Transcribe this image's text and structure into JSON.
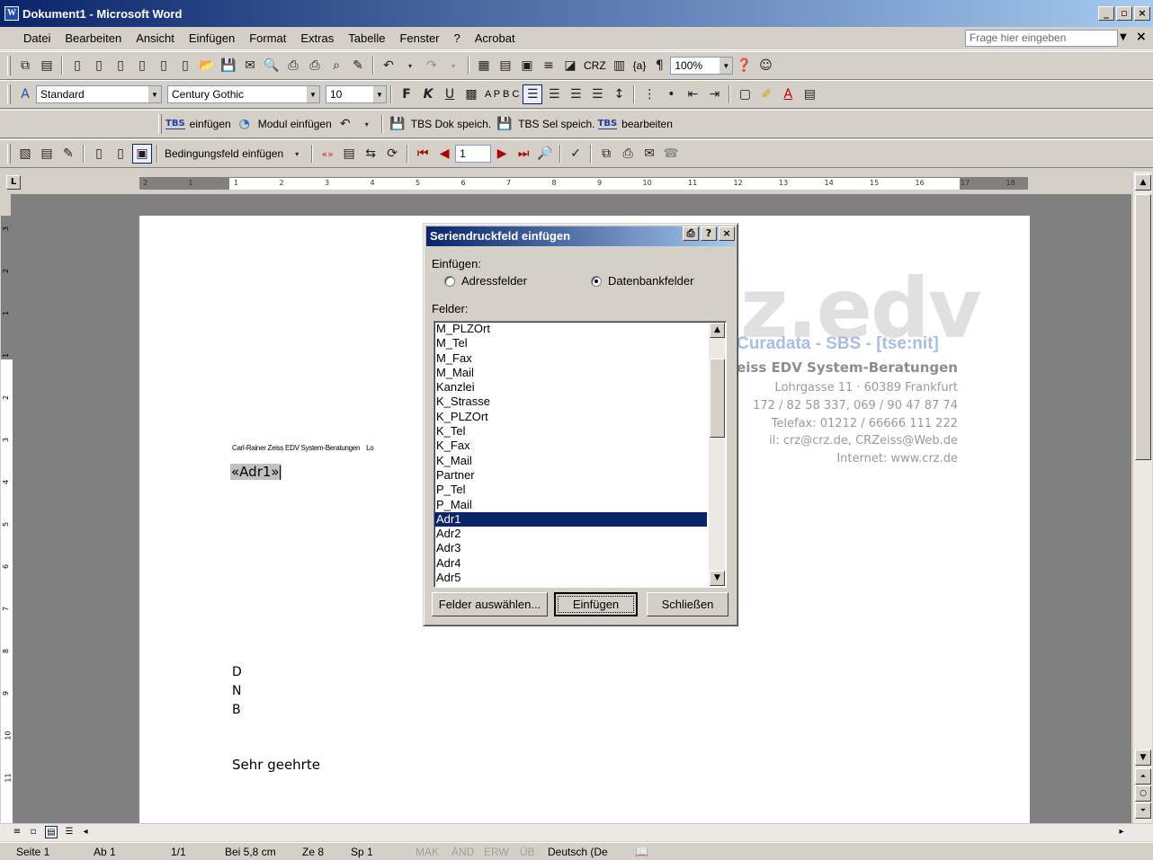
{
  "window": {
    "title": "Dokument1 - Microsoft Word",
    "buttons": [
      "_",
      "▫",
      "×"
    ]
  },
  "menu": {
    "items": [
      "Datei",
      "Bearbeiten",
      "Ansicht",
      "Einfügen",
      "Format",
      "Extras",
      "Tabelle",
      "Fenster",
      "?",
      "Acrobat"
    ],
    "help_placeholder": "Frage hier eingeben"
  },
  "formatting": {
    "style": "Standard",
    "font": "Century Gothic",
    "size": "10",
    "zoom": "100%",
    "crz_label": "CRZ",
    "field_label": "{a}",
    "abc_label": "A P B C"
  },
  "tbs_toolbar": {
    "tbs_badge": "TBS",
    "insert": "einfügen",
    "module_insert": "Modul einfügen",
    "dok_save": "TBS Dok speich.",
    "sel_save": "TBS Sel speich.",
    "edit": "bearbeiten"
  },
  "mailmerge_toolbar": {
    "condition_field": "Bedingungsfeld einfügen",
    "record": "1"
  },
  "document": {
    "sender_line": "Carl-Rainer Zeiss EDV System-Beratungen",
    "sender_line_cut": "Lo",
    "merge_field": "«Adr1»",
    "lines": [
      "D",
      "N",
      "B"
    ],
    "greeting": "Sehr geehrte",
    "logo": "z.edv",
    "logo_sub": "Curadata - SBS - [tse:nit]",
    "company": "Zeiss EDV System-Beratungen",
    "address": "Lohrgasse 11  · 60389 Frankfurt",
    "phone": "172 / 82 58 337, 069 / 90 47 87 74",
    "fax": "Telefax: 01212 / 66666 111 222",
    "mail": "il:  crz@crz.de, CRZeiss@Web.de",
    "web": "Internet: www.crz.de"
  },
  "dialog": {
    "title": "Seriendruckfeld einfügen",
    "insert_label": "Einfügen:",
    "radio_address": "Adressfelder",
    "radio_database": "Datenbankfelder",
    "fields_label": "Felder:",
    "fields": [
      "M_PLZOrt",
      "M_Tel",
      "M_Fax",
      "M_Mail",
      "Kanzlei",
      "K_Strasse",
      "K_PLZOrt",
      "K_Tel",
      "K_Fax",
      "K_Mail",
      "Partner",
      "P_Tel",
      "P_Mail",
      "Adr1",
      "Adr2",
      "Adr3",
      "Adr4",
      "Adr5"
    ],
    "selected": "Adr1",
    "btn_select": "Felder auswählen...",
    "btn_insert": "Einfügen",
    "btn_close": "Schließen"
  },
  "status": {
    "page": "Seite 1",
    "section": "Ab 1",
    "pages": "1/1",
    "at": "Bei 5,8 cm",
    "line": "Ze 8",
    "col": "Sp 1",
    "mak": "MAK",
    "and": "ÄND",
    "erw": "ERW",
    "ub": "ÜB",
    "lang": "Deutsch (De"
  },
  "ruler": {
    "h_labels": [
      "2",
      "1",
      "1",
      "2",
      "3",
      "4",
      "5",
      "6",
      "7",
      "8",
      "9",
      "10",
      "11",
      "12",
      "13",
      "14",
      "15",
      "16",
      "17",
      "18"
    ],
    "v_labels": [
      "3",
      "2",
      "1",
      "1",
      "2",
      "3",
      "4",
      "5",
      "6",
      "7",
      "8",
      "9",
      "10",
      "11"
    ]
  },
  "colors": {
    "titlebar_start": "#0a246a",
    "titlebar_end": "#a6caf0",
    "selection": "#0a246a",
    "chrome": "#d4d0c8"
  }
}
